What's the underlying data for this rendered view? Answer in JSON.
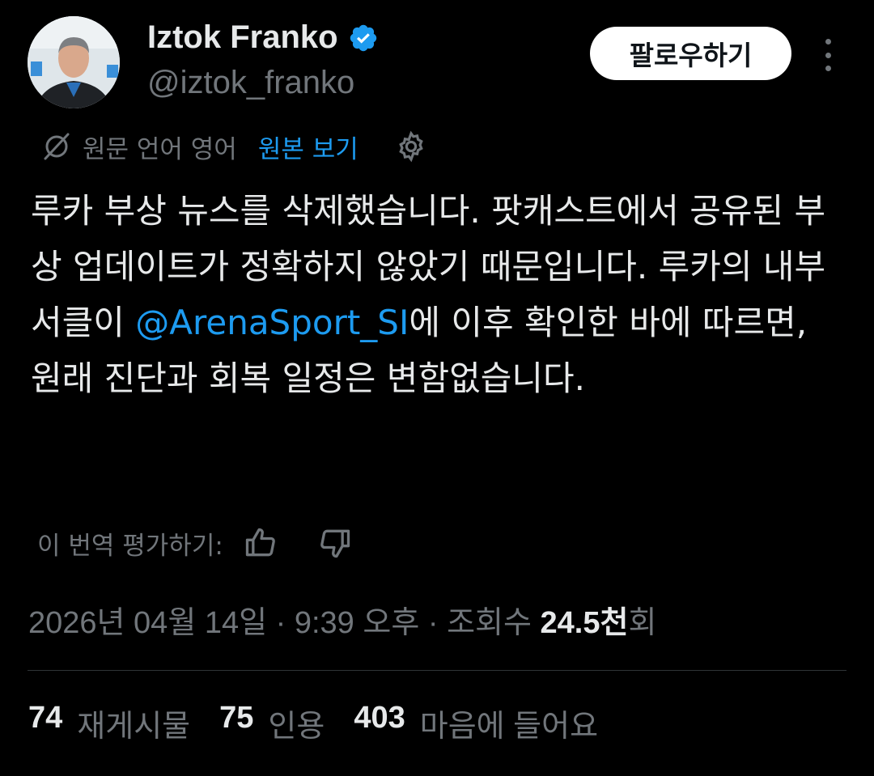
{
  "author": {
    "name": "Iztok Franko",
    "handle": "@iztok_franko",
    "avatar_icon": "avatar-photo",
    "verified_color": "#1d9bf0"
  },
  "follow_label": "팔로우하기",
  "translation": {
    "source_language": "원문 언어 영어",
    "show_original": "원본 보기"
  },
  "tweet": {
    "text_before": "루카 부상 뉴스를 삭제했습니다. 팟캐스트에서 공유된 부상 업데이트가 정확하지 않았기 때문입니다. 루카의 내부 서클이 ",
    "mention": "@ArenaSport_SI",
    "text_after": "에 이후 확인한 바에 따르면, 원래 진단과 회복 일정은 변함없습니다."
  },
  "rate_translation": "이 번역 평가하기:",
  "meta": {
    "date": "2026년 04월 14일",
    "time": "9:39 오후",
    "views_label": "조회수",
    "views_count": "24.5천",
    "views_suffix": "회"
  },
  "stats": {
    "reposts_count": "74",
    "reposts_label": "재게시물",
    "quotes_count": "75",
    "quotes_label": "인용",
    "likes_count": "403",
    "likes_label": "마음에 들어요"
  },
  "colors": {
    "background": "#000000",
    "text": "#e7e9ea",
    "muted": "#71767b",
    "accent": "#1d9bf0"
  }
}
